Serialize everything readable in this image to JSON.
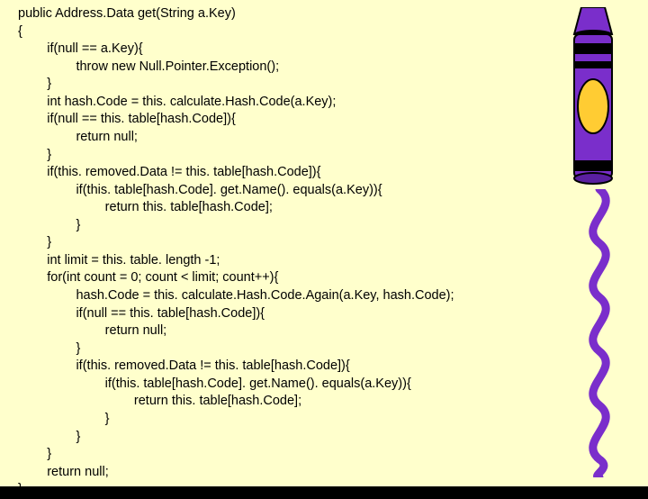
{
  "code": {
    "l1": "public Address.Data get(String a.Key)",
    "l2": "{",
    "l3": "        if(null == a.Key){",
    "l4": "                throw new Null.Pointer.Exception();",
    "l5": "        }",
    "l6": "        int hash.Code = this. calculate.Hash.Code(a.Key);",
    "l7": "        if(null == this. table[hash.Code]){",
    "l8": "                return null;",
    "l9": "        }",
    "l10": "        if(this. removed.Data != this. table[hash.Code]){",
    "l11": "                if(this. table[hash.Code]. get.Name(). equals(a.Key)){",
    "l12": "                        return this. table[hash.Code];",
    "l13": "                }",
    "l14": "        }",
    "l15": "        int limit = this. table. length -1;",
    "l16": "        for(int count = 0; count < limit; count++){",
    "l17": "                hash.Code = this. calculate.Hash.Code.Again(a.Key, hash.Code);",
    "l18": "                if(null == this. table[hash.Code]){",
    "l19": "                        return null;",
    "l20": "                }",
    "l21": "                if(this. removed.Data != this. table[hash.Code]){",
    "l22": "                        if(this. table[hash.Code]. get.Name(). equals(a.Key)){",
    "l23": "                                return this. table[hash.Code];",
    "l24": "                        }",
    "l25": "                }",
    "l26": "        }",
    "l27": "        return null;",
    "l28": "}"
  }
}
